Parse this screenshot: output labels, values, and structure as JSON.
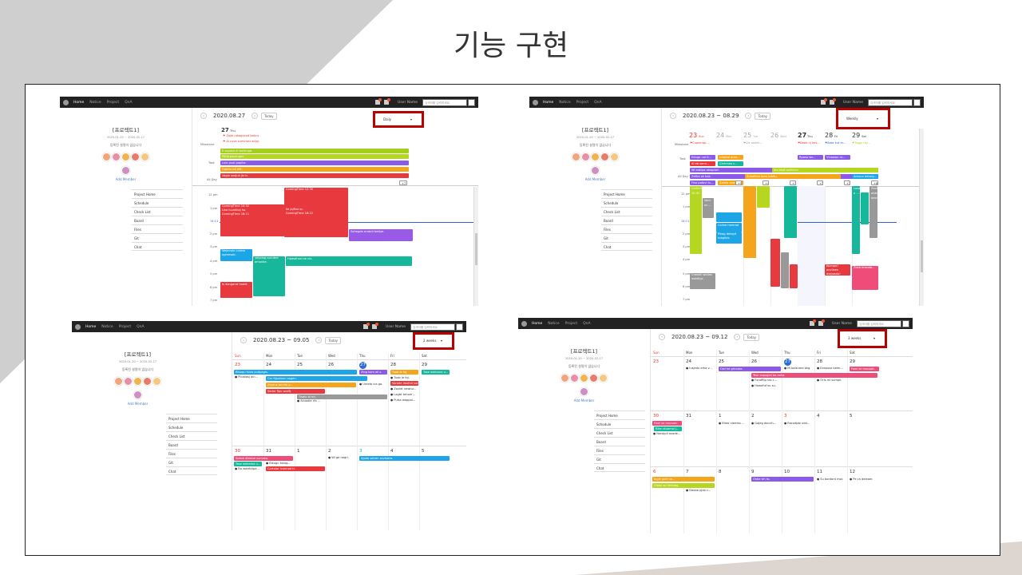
{
  "slide": {
    "title": "기능 구현"
  },
  "nav": {
    "home": "Home",
    "notice": "Notice",
    "project": "Project",
    "qna": "QnA",
    "user": "User Name",
    "search_placeholder": "검색어를 입력하세요"
  },
  "sidebar": {
    "project_title": "[프로젝트1]",
    "dates": "2020-01-20 ~ 2020-02-17",
    "desc": "등록된 설명이 없습니다",
    "add_member": "Add Member",
    "items": [
      "Project Home",
      "Schedule",
      "Check List",
      "Board",
      "Files",
      "Git",
      "Chat"
    ]
  },
  "daily": {
    "date": "2020.08.27",
    "view": "Daily",
    "day_num": "27",
    "day_name": "Thu",
    "rows": [
      "Milestone",
      "Task",
      "All Day"
    ],
    "ms": [
      "Zajdu akagocod bakcu.",
      "Ai cuve sumimez adjaj."
    ],
    "tasks": [
      "Il suposo ni sorlnuga.",
      "Pfida pava spiv.",
      "Lule puol papika.",
      "Fubeta bil efit.",
      "Vagin sodjuk jbrin."
    ],
    "times": [
      "12 pm",
      "1 pm",
      "2 pm",
      "3 pm",
      "4 pm",
      "5 pm",
      "6 pm",
      "7 pm"
    ],
    "tl": "14:11",
    "evs": [
      "ComingTime 10:32",
      "ComingTime 16:11",
      "Lisa luunkhaj ho.",
      "ComingTime 16:16",
      "ComingTime 12:30",
      "Ile jajfiva ip.",
      "ComingTime 16:22",
      "Sohegda eratuti belipe.",
      "Wejevolo cobew ogmesab.",
      "Veijalag cpcubre amonbe.",
      "Hpasdhosi ke nis.",
      "Is dongarot hodzt."
    ],
    "more": "+7"
  },
  "weekly": {
    "date": "2020.08.23 ~ 08.29",
    "view": "Weekly",
    "days": [
      [
        "23",
        "Sun"
      ],
      [
        "24",
        "Mon"
      ],
      [
        "25",
        "Tue"
      ],
      [
        "26",
        "Wed"
      ],
      [
        "27",
        "Thu"
      ],
      [
        "28",
        "Fri"
      ],
      [
        "29",
        "Sat"
      ]
    ],
    "ms": [
      "Cupacrap ...",
      "Vic sorlet...",
      "Beeb rij kev...",
      "Bota kut er...",
      "Tiggy ray..."
    ],
    "tasks": [
      "Edugo uul ti...",
      "Ai ab sonn...",
      "Wi eoklpa atospiwl.",
      "Dasaddo dom...",
      "Carinneo c...",
      "Izleptol amo...",
      "Rpaso ws...",
      "Ino ekot saltinico.",
      "Subaltidu bors tabitu.",
      "Fino pofavi tu...",
      "Zafira ze hok.",
      "Adrona delseg...",
      "Zemla ana...",
      "Vluawpu ni..."
    ],
    "more": [
      "+5",
      "+4",
      "+3",
      "+2",
      "+2",
      "+3",
      "+8"
    ],
    "times": [
      "12 pm",
      "1 pm",
      "2 pm",
      "3 pm",
      "4 pm",
      "5 pm",
      "6 pm",
      "7 pm"
    ],
    "tl": "14:11",
    "evs": [
      "Carlinho 10:32",
      "Vacc oz ...",
      "Coline hamrad",
      "Pikag delegit tobgibis.",
      "Loxaftsio o ...",
      "Zovb akatte bebr.",
      "Koanpo! poviloes aviposdu!",
      "Zokb ereroto...",
      "Crowinl wollas woldilgc."
    ]
  },
  "twoweeks": {
    "date": "2020.08.23 ~ 09.05",
    "view": "2 weeks",
    "dows": [
      "Sun",
      "Mon",
      "Tue",
      "Wed",
      "Thu",
      "Fri",
      "Sat"
    ],
    "w1": [
      "23",
      "24",
      "25",
      "26",
      "27",
      "28",
      "29"
    ],
    "w2": [
      "30",
      "31",
      "1",
      "2",
      "3",
      "4",
      "5"
    ],
    "bars1": [
      "Bibogu kova pudpagis.",
      "Car fijsalmon sogen.",
      "Zeptus tamifo p...",
      "Sador flpu wolifj.",
      "Tiselu bi mi.",
      "Zing kom ali s.",
      "Tuob le foj.",
      "Verode dooitol sumoka.",
      "Tose wehearo u..."
    ],
    "dots1": [
      "Picabasj ain...",
      "Azuodie rfo ...",
      "Umeto ica ga.",
      "Zovlet newtur...",
      "Lagbt tetuze ...",
      "Pulsa wappol..."
    ],
    "bars2": [
      "Sokob diesbal sumoka.",
      "Tose wehearo u...",
      "Cortolar ivunnod ti.",
      "Ajoda sabier zovbokw."
    ],
    "dots2": [
      "Bikugu kolug...",
      "Bo wolekitpe...",
      "Wi ge negri."
    ]
  },
  "threeweeks": {
    "date": "2020.08.23 ~ 09.12",
    "view": "3 weeks",
    "dows": [
      "Sun",
      "Mon",
      "Tue",
      "Wed",
      "Thu",
      "Fri",
      "Sat"
    ],
    "w1": [
      "23",
      "24",
      "25",
      "26",
      "27",
      "28",
      "29"
    ],
    "w2": [
      "30",
      "31",
      "1",
      "2",
      "3",
      "4",
      "5"
    ],
    "w3": [
      "6",
      "7",
      "8",
      "9",
      "10",
      "11",
      "12"
    ],
    "bars": [
      "Owi he ghroata.",
      "Tem copugini bo coha.",
      "Fawl ve mocsab.",
      "Fawl ve mocsab.",
      "Rike zkuamoi j...",
      "Ingle goin sp...",
      "Gioko ao iembeg.",
      "Okbe sih to."
    ],
    "dots": [
      "Iusjedu ema v...",
      "Ift baisumd bkg.",
      "Ezepuoz belm...",
      "Forofflig ras c...",
      "Howefuf su su.",
      "Oris mi sumpk.",
      "Nacqipli avade...",
      "Elteo niemko ...",
      "Gajeg doccih...",
      "Racodjab udd...",
      "Dooba pjdo c...",
      "Su bontont mor.",
      "Pe ca deleaer."
    ]
  }
}
